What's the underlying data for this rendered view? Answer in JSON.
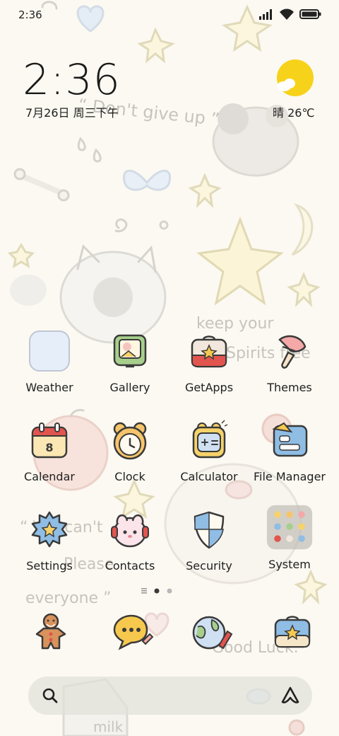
{
  "status_bar": {
    "time": "2:36",
    "icons": [
      "signal-icon",
      "wifi-icon",
      "battery-icon"
    ]
  },
  "clock_widget": {
    "time": "2:36",
    "date": "7月26日 周三下午"
  },
  "weather_widget": {
    "text": "晴 26℃",
    "icon": "sunny-icon"
  },
  "apps": [
    {
      "label": "Weather",
      "icon": "weather-app-icon"
    },
    {
      "label": "Gallery",
      "icon": "gallery-app-icon"
    },
    {
      "label": "GetApps",
      "icon": "getapps-app-icon"
    },
    {
      "label": "Themes",
      "icon": "themes-app-icon"
    },
    {
      "label": "Calendar",
      "icon": "calendar-app-icon",
      "badge": "8"
    },
    {
      "label": "Clock",
      "icon": "clock-app-icon"
    },
    {
      "label": "Calculator",
      "icon": "calculator-app-icon"
    },
    {
      "label": "File Manager",
      "icon": "file-manager-app-icon"
    },
    {
      "label": "Settings",
      "icon": "settings-app-icon"
    },
    {
      "label": "Contacts",
      "icon": "contacts-app-icon"
    },
    {
      "label": "Security",
      "icon": "security-app-icon"
    },
    {
      "label": "System",
      "icon": "system-folder-icon"
    }
  ],
  "page_indicator": {
    "pages": 2,
    "current": 1
  },
  "dock": [
    {
      "icon": "phone-gingerbread-icon"
    },
    {
      "icon": "messages-icon"
    },
    {
      "icon": "browser-globe-icon"
    },
    {
      "icon": "app-store-icon"
    }
  ],
  "search_bar": {
    "icons": [
      "search-icon",
      "assistant-icon"
    ]
  },
  "wallpaper_text": [
    "“ Don't give up ”",
    "keep your",
    "Spirits free",
    "“ You can't",
    "Please",
    "everyone ”",
    "Good Luck.",
    "milk"
  ],
  "colors": {
    "background": "#fbf9f1",
    "sun": "#f7d21a",
    "text": "#1f1f1f"
  }
}
